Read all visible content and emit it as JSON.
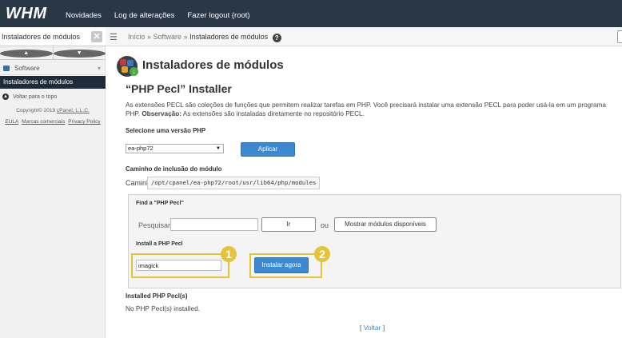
{
  "brand": {
    "logo": "WHM"
  },
  "topnav": {
    "news": "Novidades",
    "changelog": "Log de alterações",
    "logout": "Fazer logout (root)"
  },
  "sidebar": {
    "search_value": "Instaladores de módulos",
    "clear": "✕",
    "category": "Software",
    "active_item": "Instaladores de módulos",
    "back_to_top": "Voltar para o topo",
    "copyright_prefix": "Copyright© 2019 ",
    "copyright_company": "cPanel, L.L.C.",
    "links": [
      "EULA",
      "Marcas comerciais",
      "Privacy Policy"
    ]
  },
  "breadcrumb": {
    "home": "Início",
    "sep1": " » ",
    "section": "Software",
    "sep2": " » ",
    "current": "Instaladores de módulos",
    "help": "?"
  },
  "page": {
    "title": "Instaladores de módulos",
    "subtitle": "“PHP Pecl” Installer",
    "desc_part1": "As extensões PECL são coleções de funções que permitem realizar tarefas em PHP. Você precisará instalar uma extensão PECL para poder usá-la em um programa PHP. ",
    "desc_bold": "Observação:",
    "desc_part2": " As extensões são instaladas diretamente no repositório PECL.",
    "select_version_label": "Selecione uma versão PHP",
    "php_version": "ea-php72",
    "apply_button": "Aplicar",
    "include_path_heading": "Caminho de inclusão do módulo",
    "include_path_label": "Caminho",
    "include_path_value": "/opt/cpanel/ea-php72/root/usr/lib64/php/modules",
    "find_label": "Find a \"PHP Pecl\"",
    "search_label": "Pesquisar",
    "search_value": "",
    "go_button": "Ir",
    "or_text": "ou",
    "show_available_button": "Mostrar módulos disponíveis",
    "install_label": "Install a PHP Pecl",
    "install_value": "imagick",
    "install_button": "Instalar agora",
    "callouts": [
      "1",
      "2"
    ],
    "installed_label": "Installed PHP Pecl(s)",
    "installed_text": "No PHP Pecl(s) installed.",
    "back_open": "[ ",
    "back_link": "Voltar",
    "back_close": " ]"
  },
  "colors": {
    "topbar": "#2a3746",
    "primary_button": "#3e88cf",
    "highlight": "#e7c33a",
    "sidebar_active": "#1e2c3a"
  }
}
